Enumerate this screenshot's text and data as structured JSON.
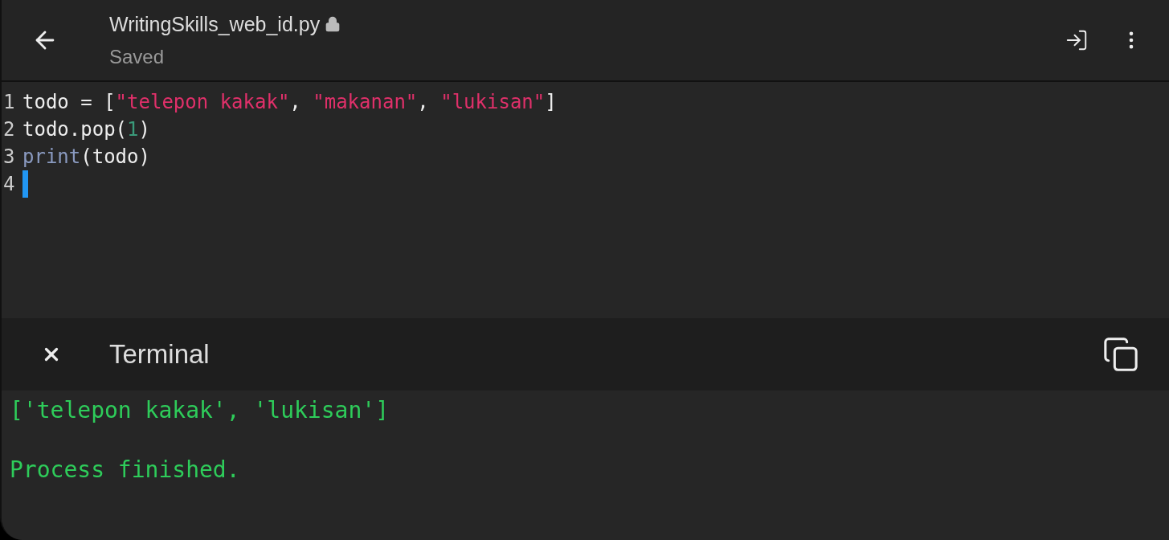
{
  "header": {
    "title": "WritingSkills_web_id.py",
    "locked": true,
    "status": "Saved"
  },
  "editor": {
    "lines": [
      {
        "number": "1",
        "tokens": [
          {
            "kind": "plain",
            "text": "todo = ["
          },
          {
            "kind": "string",
            "text": "\"telepon kakak\""
          },
          {
            "kind": "plain",
            "text": ", "
          },
          {
            "kind": "string",
            "text": "\"makanan\""
          },
          {
            "kind": "plain",
            "text": ", "
          },
          {
            "kind": "string",
            "text": "\"lukisan\""
          },
          {
            "kind": "plain",
            "text": "]"
          }
        ],
        "cursor": false
      },
      {
        "number": "2",
        "tokens": [
          {
            "kind": "plain",
            "text": "todo.pop("
          },
          {
            "kind": "number",
            "text": "1"
          },
          {
            "kind": "plain",
            "text": ")"
          }
        ],
        "cursor": false
      },
      {
        "number": "3",
        "tokens": [
          {
            "kind": "builtin",
            "text": "print"
          },
          {
            "kind": "plain",
            "text": "(todo)"
          }
        ],
        "cursor": false
      },
      {
        "number": "4",
        "cursor": true
      }
    ]
  },
  "terminal": {
    "title": "Terminal",
    "output": [
      {
        "kind": "result",
        "text": "['telepon kakak', 'lukisan']"
      },
      {
        "kind": "status",
        "text": "Process finished."
      }
    ]
  }
}
